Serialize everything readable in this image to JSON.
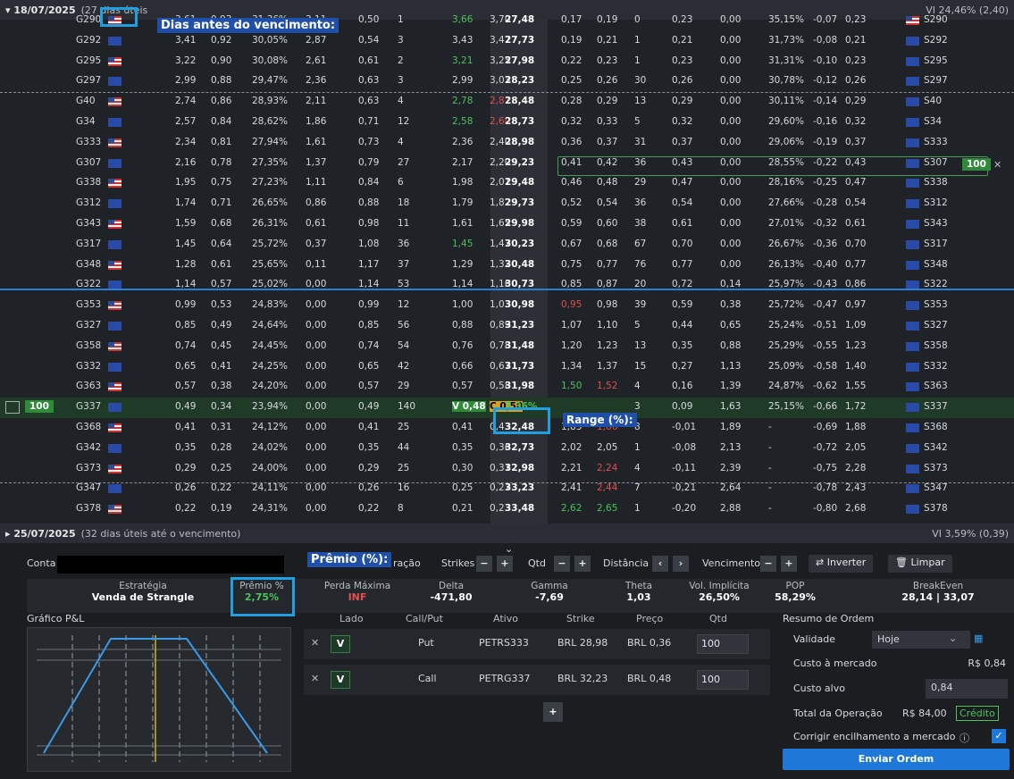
{
  "expiry1": {
    "date": "▾ 18/07/2025",
    "days": "(27 dias úteis",
    "vi": "VI 24,46% (2,40)"
  },
  "expiry2": {
    "date": "▸ 25/07/2025",
    "days": "(32 dias úteis até o vencimento)",
    "vi": "VI 3,59% (0,39)"
  },
  "annotations": {
    "days_label": "Dias antes do vencimento:",
    "range_label": "Range (%):",
    "premio_label": "Prêmio (%):"
  },
  "chain_rows": [
    [
      "G290",
      "us",
      "3,61",
      "0,93",
      "31,36%",
      "3,11",
      "0,50",
      "1",
      "3,66",
      "3,70",
      "27,48",
      "0,17",
      "0,19",
      "0",
      "0,23",
      "0,00",
      "35,15%",
      "-0,07",
      "0,23",
      "us",
      "S290"
    ],
    [
      "G292",
      "eu",
      "3,41",
      "0,92",
      "30,05%",
      "2,87",
      "0,54",
      "3",
      "3,43",
      "3,47",
      "27,73",
      "0,19",
      "0,21",
      "1",
      "0,21",
      "0,00",
      "31,73%",
      "-0,08",
      "0,21",
      "eu",
      "S292"
    ],
    [
      "G295",
      "us",
      "3,22",
      "0,90",
      "30,08%",
      "2,61",
      "0,61",
      "2",
      "3,21",
      "3,25",
      "27,98",
      "0,22",
      "0,23",
      "1",
      "0,23",
      "0,00",
      "31,31%",
      "-0,10",
      "0,23",
      "eu",
      "S295"
    ],
    [
      "G297",
      "eu",
      "2,99",
      "0,88",
      "29,47%",
      "2,36",
      "0,63",
      "3",
      "2,99",
      "3,03",
      "28,23",
      "0,25",
      "0,26",
      "30",
      "0,26",
      "0,00",
      "30,78%",
      "-0,12",
      "0,26",
      "eu",
      "S297"
    ],
    [
      "G40",
      "us",
      "2,74",
      "0,86",
      "28,93%",
      "2,11",
      "0,63",
      "4",
      "2,78",
      "2,81",
      "28,48",
      "0,28",
      "0,29",
      "13",
      "0,29",
      "0,00",
      "30,11%",
      "-0,14",
      "0,29",
      "eu",
      "S40"
    ],
    [
      "G34",
      "eu",
      "2,57",
      "0,84",
      "28,62%",
      "1,86",
      "0,71",
      "12",
      "2,58",
      "2,60",
      "28,73",
      "0,32",
      "0,33",
      "5",
      "0,32",
      "0,00",
      "29,60%",
      "-0,16",
      "0,32",
      "eu",
      "S34"
    ],
    [
      "G333",
      "us",
      "2,34",
      "0,81",
      "27,94%",
      "1,61",
      "0,73",
      "4",
      "2,36",
      "2,40",
      "28,98",
      "0,36",
      "0,37",
      "31",
      "0,37",
      "0,00",
      "29,06%",
      "-0,19",
      "0,37",
      "eu",
      "S333"
    ],
    [
      "G307",
      "eu",
      "2,16",
      "0,78",
      "27,35%",
      "1,37",
      "0,79",
      "27",
      "2,17",
      "2,20",
      "29,23",
      "0,41",
      "0,42",
      "36",
      "0,43",
      "0,00",
      "28,55%",
      "-0,22",
      "0,43",
      "eu",
      "S307"
    ],
    [
      "G338",
      "us",
      "1,95",
      "0,75",
      "27,23%",
      "1,11",
      "0,84",
      "6",
      "1,98",
      "2,01",
      "29,48",
      "0,46",
      "0,48",
      "29",
      "0,47",
      "0,00",
      "28,16%",
      "-0,25",
      "0,47",
      "eu",
      "S338"
    ],
    [
      "G312",
      "eu",
      "1,74",
      "0,71",
      "26,65%",
      "0,86",
      "0,88",
      "18",
      "1,79",
      "1,82",
      "29,73",
      "0,52",
      "0,54",
      "36",
      "0,54",
      "0,00",
      "27,66%",
      "-0,28",
      "0,54",
      "eu",
      "S312"
    ],
    [
      "G343",
      "us",
      "1,59",
      "0,68",
      "26,31%",
      "0,61",
      "0,98",
      "11",
      "1,61",
      "1,65",
      "29,98",
      "0,59",
      "0,60",
      "38",
      "0,61",
      "0,00",
      "27,01%",
      "-0,32",
      "0,61",
      "eu",
      "S343"
    ],
    [
      "G317",
      "eu",
      "1,45",
      "0,64",
      "25,72%",
      "0,37",
      "1,08",
      "36",
      "1,45",
      "1,47",
      "30,23",
      "0,67",
      "0,68",
      "67",
      "0,70",
      "0,00",
      "26,67%",
      "-0,36",
      "0,70",
      "eu",
      "S317"
    ],
    [
      "G348",
      "us",
      "1,28",
      "0,61",
      "25,65%",
      "0,11",
      "1,17",
      "37",
      "1,29",
      "1,32",
      "30,48",
      "0,75",
      "0,77",
      "76",
      "0,77",
      "0,00",
      "26,13%",
      "-0,40",
      "0,77",
      "eu",
      "S348"
    ],
    [
      "G322",
      "eu",
      "1,14",
      "0,57",
      "25,02%",
      "0,00",
      "1,14",
      "53",
      "1,14",
      "1,16",
      "30,73",
      "0,85",
      "0,87",
      "20",
      "0,72",
      "0,14",
      "25,97%",
      "-0,43",
      "0,86",
      "eu",
      "S322"
    ],
    [
      "G353",
      "us",
      "0,99",
      "0,53",
      "24,83%",
      "0,00",
      "0,99",
      "12",
      "1,00",
      "1,03",
      "30,98",
      "0,95",
      "0,98",
      "39",
      "0,59",
      "0,38",
      "25,72%",
      "-0,47",
      "0,97",
      "eu",
      "S353"
    ],
    [
      "G327",
      "eu",
      "0,85",
      "0,49",
      "24,64%",
      "0,00",
      "0,85",
      "56",
      "0,88",
      "0,89",
      "31,23",
      "1,07",
      "1,10",
      "5",
      "0,44",
      "0,65",
      "25,24%",
      "-0,51",
      "1,09",
      "eu",
      "S327"
    ],
    [
      "G358",
      "us",
      "0,74",
      "0,45",
      "24,45%",
      "0,00",
      "0,74",
      "54",
      "0,76",
      "0,78",
      "31,48",
      "1,20",
      "1,23",
      "13",
      "0,35",
      "0,88",
      "25,29%",
      "-0,55",
      "1,23",
      "eu",
      "S358"
    ],
    [
      "G332",
      "eu",
      "0,65",
      "0,41",
      "24,25%",
      "0,00",
      "0,65",
      "42",
      "0,66",
      "0,67",
      "31,73",
      "1,34",
      "1,37",
      "15",
      "0,27",
      "1,13",
      "25,09%",
      "-0,58",
      "1,40",
      "eu",
      "S332"
    ],
    [
      "G363",
      "us",
      "0,57",
      "0,38",
      "24,20%",
      "0,00",
      "0,57",
      "29",
      "0,57",
      "0,58",
      "31,98",
      "1,50",
      "1,52",
      "4",
      "0,16",
      "1,39",
      "24,87%",
      "-0,62",
      "1,55",
      "eu",
      "S363"
    ],
    [
      "G337",
      "eu",
      "0,49",
      "0,34",
      "23,94%",
      "0,00",
      "0,49",
      "140",
      "V 0,48",
      "C 0,50",
      "5,36%",
      "",
      "",
      "3",
      "0,09",
      "1,63",
      "25,15%",
      "-0,66",
      "1,72",
      "eu",
      "S337"
    ],
    [
      "G368",
      "us",
      "0,41",
      "0,31",
      "24,12%",
      "0,00",
      "0,41",
      "25",
      "0,41",
      "0,43",
      "32,48",
      "1,83",
      "1,86",
      "8",
      "-0,01",
      "1,89",
      "-",
      "-0,69",
      "1,88",
      "eu",
      "S368"
    ],
    [
      "G342",
      "eu",
      "0,35",
      "0,28",
      "24,02%",
      "0,00",
      "0,35",
      "44",
      "0,35",
      "0,36",
      "32,73",
      "2,02",
      "2,05",
      "1",
      "-0,08",
      "2,13",
      "-",
      "-0,72",
      "2,05",
      "eu",
      "S342"
    ],
    [
      "G373",
      "us",
      "0,29",
      "0,25",
      "24,00%",
      "0,00",
      "0,29",
      "25",
      "0,30",
      "0,31",
      "32,98",
      "2,21",
      "2,24",
      "4",
      "-0,11",
      "2,39",
      "-",
      "-0,75",
      "2,28",
      "eu",
      "S373"
    ],
    [
      "G347",
      "eu",
      "0,26",
      "0,22",
      "24,11%",
      "0,00",
      "0,26",
      "16",
      "0,25",
      "0,27",
      "33,23",
      "2,41",
      "2,44",
      "7",
      "-0,21",
      "2,64",
      "-",
      "-0,78",
      "2,43",
      "eu",
      "S347"
    ],
    [
      "G378",
      "us",
      "0,22",
      "0,19",
      "24,31%",
      "0,00",
      "0,22",
      "8",
      "0,21",
      "0,23",
      "33,48",
      "2,62",
      "2,65",
      "1",
      "-0,20",
      "2,88",
      "-",
      "-0,80",
      "2,68",
      "eu",
      "S378"
    ]
  ],
  "selected": {
    "put_qty": "100",
    "call_qty": "100"
  },
  "toolbar": {
    "conta_label": "Conta",
    "duracao": "ração",
    "strikes": "Strikes",
    "qtd": "Qtd",
    "distancia": "Distância",
    "vencimento": "Vencimento",
    "inverter": "⇄ Inverter",
    "limpar": "🗑 Limpar"
  },
  "summary": {
    "estrategia_lbl": "Estratégia",
    "estrategia_val": "Venda de Strangle",
    "premio_lbl": "Prêmio %",
    "premio_val": "2,75%",
    "perda_lbl": "Perda Máxima",
    "perda_val": "INF",
    "delta_lbl": "Delta",
    "delta_val": "-471,80",
    "gamma_lbl": "Gamma",
    "gamma_val": "-7,69",
    "theta_lbl": "Theta",
    "theta_val": "1,03",
    "vol_lbl": "Vol. Implícita",
    "vol_val": "26,50%",
    "pop_lbl": "POP",
    "pop_val": "58,29%",
    "be_lbl": "BreakEven",
    "be_val": "28,14 | 33,07"
  },
  "pnl_title": "Gráfico P&L",
  "legs_head": {
    "lado": "Lado",
    "callput": "Call/Put",
    "ativo": "Ativo",
    "strike": "Strike",
    "preco": "Preço",
    "qtd": "Qtd"
  },
  "legs": [
    {
      "lado": "V",
      "tipo": "Put",
      "ativo": "PETRS333",
      "strike": "BRL 28,98",
      "preco": "BRL 0,36",
      "qtd": "100"
    },
    {
      "lado": "V",
      "tipo": "Call",
      "ativo": "PETRG337",
      "strike": "BRL 32,23",
      "preco": "BRL 0,48",
      "qtd": "100"
    }
  ],
  "order": {
    "title": "Resumo de Ordem",
    "validade_lbl": "Validade",
    "validade_val": "Hoje",
    "custo_mercado_lbl": "Custo à mercado",
    "custo_mercado_val": "R$ 0,84",
    "custo_alvo_lbl": "Custo alvo",
    "custo_alvo_val": "0,84",
    "total_lbl": "Total da Operação",
    "total_val": "R$ 84,00",
    "credito": "Crédito",
    "corrigir_lbl": "Corrigir encilhamento a mercado",
    "send": "Enviar Ordem"
  }
}
